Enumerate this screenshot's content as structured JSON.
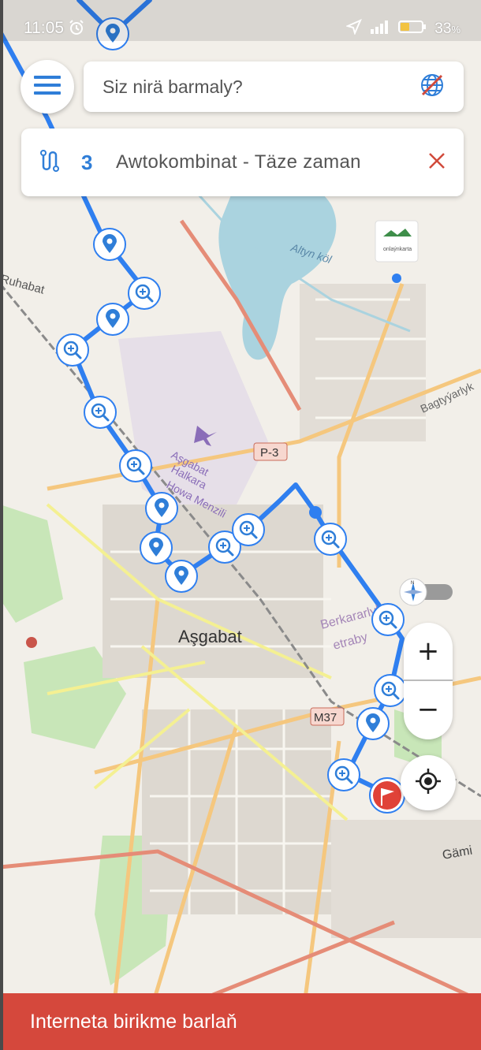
{
  "status_bar": {
    "time": "11:05",
    "battery": "33",
    "battery_unit": "%",
    "icons": [
      "alarm-icon",
      "location-arrow-icon",
      "signal-icon",
      "battery-icon"
    ]
  },
  "search": {
    "placeholder": "Siz nirä barmaly?",
    "menu_icon": "hamburger-menu-icon",
    "right_icon": "globe-offline-icon"
  },
  "route": {
    "icon": "route-icon",
    "number": "3",
    "name": "Awtokombinat - Täze zaman",
    "close_icon": "close-icon"
  },
  "map": {
    "labels": {
      "city": "Aşgabat",
      "lake": "Altyn köl",
      "district_nw": "Ruhabat",
      "district_e": "Bagtyýarlyk",
      "district_e2": "Berkararlyk",
      "district_e2_sub": "etraby",
      "airport_1": "Aşgabat",
      "airport_2": "Halkara",
      "airport_3": "Howa Menzili",
      "road_p3": "P-3",
      "road_m37": "M37",
      "district_se": "Gämi",
      "logo_text": "onlaýnkarta"
    }
  },
  "controls": {
    "zoom_in": "+",
    "zoom_out": "−",
    "compass_icon": "compass-icon",
    "locate_icon": "locate-me-icon"
  },
  "banner": {
    "text": "Interneta birikme barlaň"
  },
  "colors": {
    "route": "#2f7ff0",
    "accent": "#2f7ed8",
    "close": "#d14a3b",
    "banner": "#d5483c",
    "map_bg": "#f2efe9"
  }
}
